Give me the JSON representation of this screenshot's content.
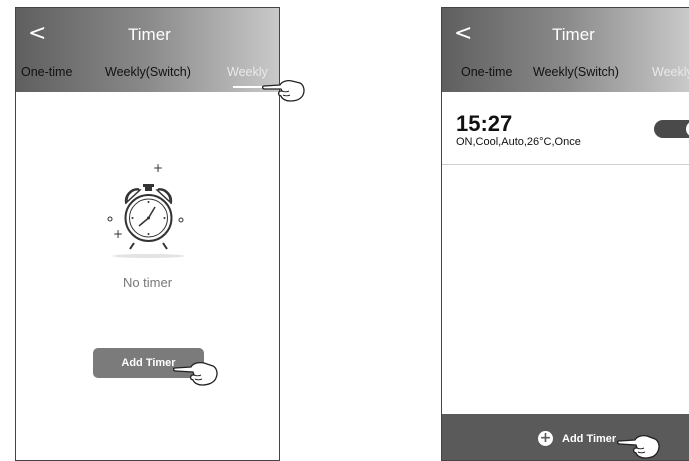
{
  "left_screen": {
    "header": {
      "back_icon": "chevron-left-icon",
      "back_glyph": "<",
      "title": "Timer",
      "tabs": [
        {
          "label": "One-time",
          "active": false
        },
        {
          "label": "Weekly(Switch)",
          "active": false
        },
        {
          "label": "Weekly",
          "active": true
        }
      ]
    },
    "empty_state": {
      "icon": "alarm-clock-icon",
      "text": "No timer"
    },
    "add_timer_button": {
      "label": "Add Timer"
    }
  },
  "right_screen": {
    "header": {
      "back_icon": "chevron-left-icon",
      "back_glyph": "<",
      "title": "Timer",
      "tabs": [
        {
          "label": "One-time",
          "active": false
        },
        {
          "label": "Weekly(Switch)",
          "active": false
        },
        {
          "label": "Weekly",
          "active": true
        }
      ]
    },
    "timers": [
      {
        "time": "15:27",
        "details": "ON,Cool,Auto,26°C,Once",
        "enabled": true
      }
    ],
    "footer": {
      "icon": "plus-circle-icon",
      "label": "Add Timer"
    }
  },
  "hand_icon": "pointing-hand-icon",
  "colors": {
    "header_dark": "#5f5f5f",
    "header_light": "#c9c9c9",
    "button_gray": "#7b7b7b",
    "footer_gray": "#5a5a5a",
    "toggle": "#4a4a4a"
  }
}
